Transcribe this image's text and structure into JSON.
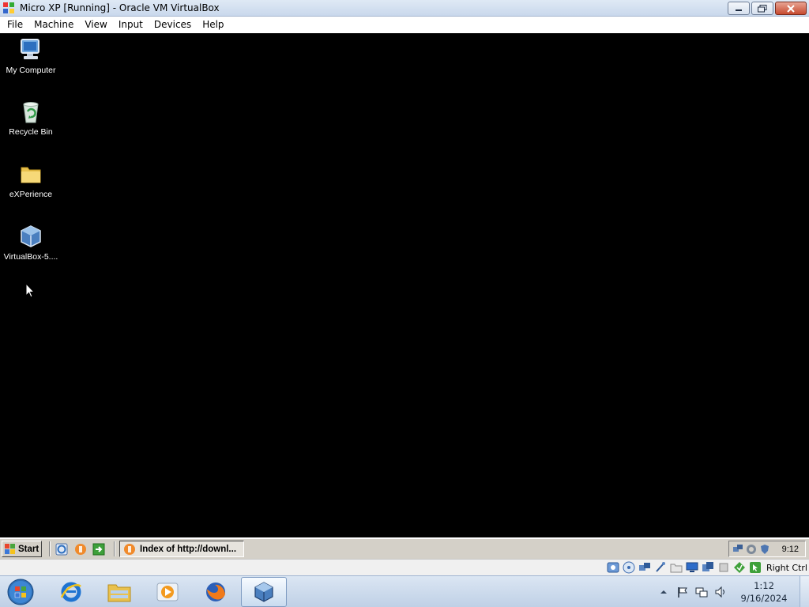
{
  "window": {
    "title": "Micro XP [Running] - Oracle VM VirtualBox",
    "icon": "virtualbox-app-icon"
  },
  "menubar": {
    "items": [
      "File",
      "Machine",
      "View",
      "Input",
      "Devices",
      "Help"
    ]
  },
  "guest_desktop": {
    "icons": [
      {
        "label": "My Computer",
        "icon": "my-computer-icon"
      },
      {
        "label": "Recycle Bin",
        "icon": "recycle-bin-icon"
      },
      {
        "label": "eXPerience",
        "icon": "folder-icon"
      },
      {
        "label": "VirtualBox-5....",
        "icon": "virtualbox-installer-icon"
      }
    ]
  },
  "guest_taskbar": {
    "start_label": "Start",
    "quick_launch": [
      "ie-icon",
      "orange-browser-icon",
      "show-desktop-arrow-icon"
    ],
    "task_button": "Index of http://downl...",
    "tray_clock": "9:12"
  },
  "vbox_status": {
    "host_key": "Right Ctrl"
  },
  "host_taskbar": {
    "pinned": [
      "internet-explorer-icon",
      "windows-explorer-icon",
      "media-player-icon",
      "firefox-icon",
      "virtualbox-icon"
    ],
    "active_index": 4,
    "clock_time": "1:12",
    "clock_date": "9/16/2024"
  },
  "colors": {
    "desktop_bg": "#000000",
    "xp_taskbar": "#d4d0c8",
    "win7_taskbar": "#c7d7ea"
  }
}
